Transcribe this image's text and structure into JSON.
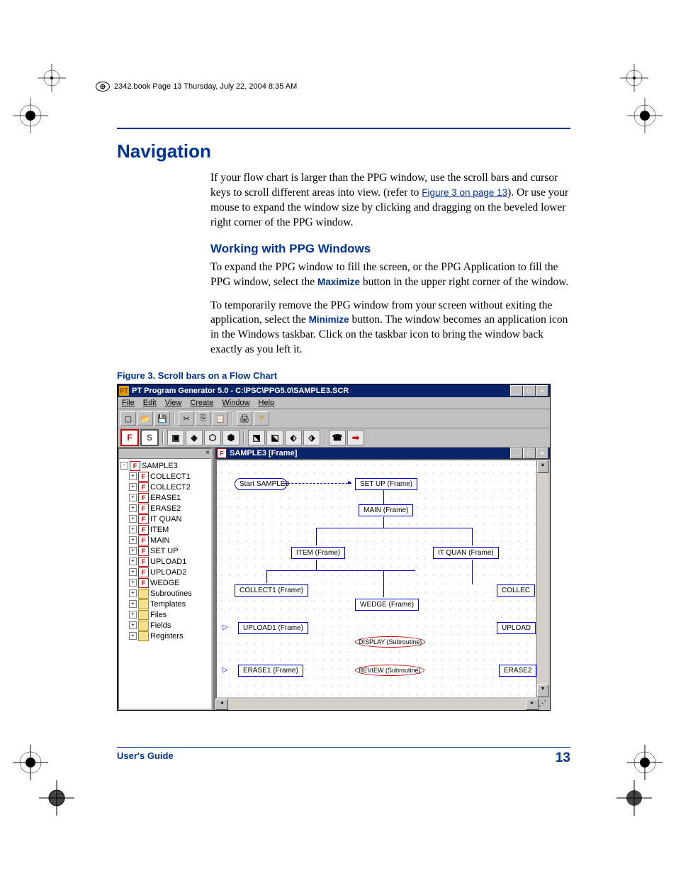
{
  "header_text": "2342.book  Page 13  Thursday, July 22, 2004  8:35 AM",
  "heading": "Navigation",
  "para1a": "If your flow chart is larger than the PPG window, use the scroll bars and cursor keys to scroll different areas into view. (refer to ",
  "para1_link": "Figure 3 on page 13",
  "para1b": "). Or use your mouse to expand the window size by clicking and dragging on the beveled lower right corner of the PPG window.",
  "subheading": "Working with PPG Windows",
  "para2a": "To expand the PPG window to fill the screen, or the PPG Application to fill the PPG window, select the ",
  "para2_bold": "Maximize",
  "para2b": " button in the upper right corner of the window.",
  "para3a": "To temporarily remove the PPG window from your screen without exiting the application, select the ",
  "para3_bold": "Minimize",
  "para3b": " button. The window becomes an application icon in the Windows taskbar. Click on the taskbar icon to bring the window back exactly as you left it.",
  "figure_caption": "Figure 3. Scroll bars on a Flow Chart",
  "app": {
    "title": "PT Program Generator 5.0 - C:\\PSC\\PPG5.0\\SAMPLE3.SCR",
    "menu": [
      "File",
      "Edit",
      "View",
      "Create",
      "Window",
      "Help"
    ],
    "canvas_title": "SAMPLE3 [Frame]",
    "tree_root": "SAMPLE3",
    "tree_frames": [
      "COLLECT1",
      "COLLECT2",
      "ERASE1",
      "ERASE2",
      "IT QUAN",
      "ITEM",
      "MAIN",
      "SET UP",
      "UPLOAD1",
      "UPLOAD2",
      "WEDGE"
    ],
    "tree_folders": [
      "Subroutines",
      "Templates",
      "Files",
      "Fields",
      "Registers"
    ],
    "nodes": {
      "start": "Start\nSAMPLE3",
      "setup": "SET UP (Frame)",
      "main": "MAIN (Frame)",
      "item": "ITEM (Frame)",
      "itquan": "IT QUAN (Frame)",
      "collect1": "COLLECT1 (Frame)",
      "collect2": "COLLEC",
      "wedge": "WEDGE (Frame)",
      "upload1": "UPLOAD1 (Frame)",
      "upload2": "UPLOAD",
      "erase1": "ERASE1 (Frame)",
      "erase2": "ERASE2",
      "display": "DISPLAY (Subroutine)",
      "review": "REVIEW (Subroutine)"
    }
  },
  "footer_left": "User's Guide",
  "footer_right": "13"
}
